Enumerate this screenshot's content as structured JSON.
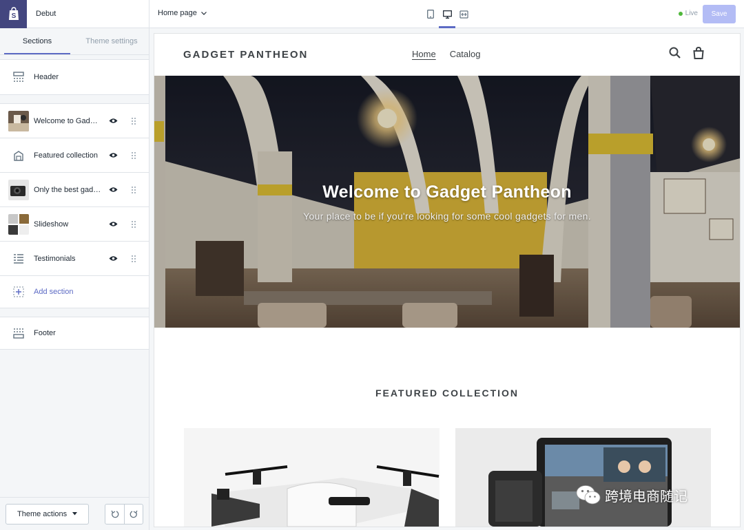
{
  "sidebar": {
    "theme_name": "Debut",
    "tabs": [
      {
        "label": "Sections",
        "active": true
      },
      {
        "label": "Theme settings",
        "active": false
      }
    ],
    "header_item": {
      "label": "Header",
      "icon": "header-layout-icon"
    },
    "sections": [
      {
        "label": "Welcome to Gadget Pantheon",
        "icon": "image-thumbnail"
      },
      {
        "label": "Featured collection",
        "icon": "collection-icon"
      },
      {
        "label": "Only the best gadgets",
        "icon": "image-thumbnail"
      },
      {
        "label": "Slideshow",
        "icon": "image-thumbnail"
      },
      {
        "label": "Testimonials",
        "icon": "list-icon"
      }
    ],
    "add_section_label": "Add section",
    "footer_item": {
      "label": "Footer",
      "icon": "footer-layout-icon"
    },
    "theme_actions_label": "Theme actions"
  },
  "topbar": {
    "page_select": "Home page",
    "status": "Live",
    "save_label": "Save",
    "status_color": "#50b83c",
    "accent_color": "#5c6ac4"
  },
  "preview": {
    "store_name": "GADGET PANTHEON",
    "nav": [
      {
        "label": "Home",
        "current": true
      },
      {
        "label": "Catalog",
        "current": false
      }
    ],
    "hero_title": "Welcome to Gadget Pantheon",
    "hero_subtitle": "Your place to be if you're looking for some cool gadgets for men.",
    "featured_title": "FEATURED COLLECTION"
  },
  "watermark": "跨境电商随记"
}
